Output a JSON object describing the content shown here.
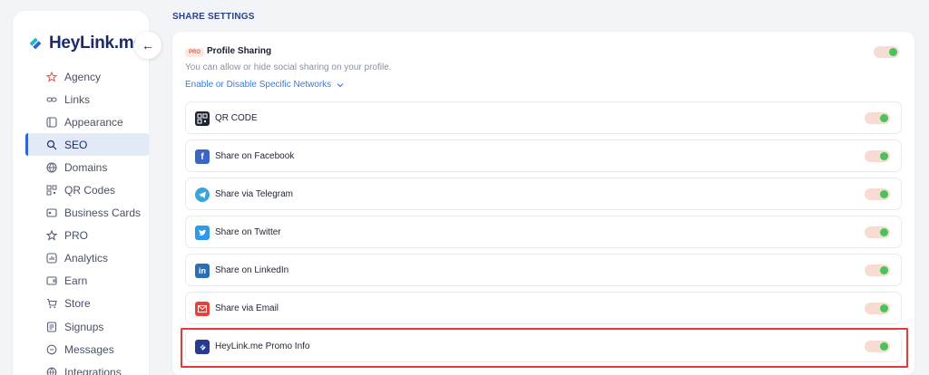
{
  "app": {
    "logo_text": "HeyLink.me",
    "collapse_icon": "arrow-left-icon"
  },
  "sidebar": {
    "items": [
      {
        "label": "Agency",
        "icon": "star-icon",
        "icon_color": "#e0644f"
      },
      {
        "label": "Links",
        "icon": "link-icon"
      },
      {
        "label": "Appearance",
        "icon": "palette-icon"
      },
      {
        "label": "SEO",
        "icon": "seo-icon",
        "active": true
      },
      {
        "label": "Domains",
        "icon": "globe-icon"
      },
      {
        "label": "QR Codes",
        "icon": "qr-icon"
      },
      {
        "label": "Business Cards",
        "icon": "id-card-icon"
      },
      {
        "label": "PRO",
        "icon": "crown-icon"
      },
      {
        "label": "Analytics",
        "icon": "chart-icon"
      },
      {
        "label": "Earn",
        "icon": "wallet-icon"
      },
      {
        "label": "Store",
        "icon": "cart-icon"
      },
      {
        "label": "Signups",
        "icon": "form-icon"
      },
      {
        "label": "Messages",
        "icon": "message-icon"
      },
      {
        "label": "Integrations",
        "icon": "plug-icon"
      }
    ]
  },
  "main": {
    "section_title": "SHARE SETTINGS",
    "profile_sharing": {
      "badge": "PRO",
      "title": "Profile Sharing",
      "description": "You can allow or hide social sharing on your profile.",
      "link": "Enable or Disable Specific Networks",
      "enabled": true
    },
    "networks": [
      {
        "label": "QR CODE",
        "icon": "qr-code-icon",
        "icon_color": "#1f2433",
        "enabled": true
      },
      {
        "label": "Share on Facebook",
        "icon": "facebook-icon",
        "icon_color": "#3b66c4",
        "enabled": true
      },
      {
        "label": "Share via Telegram",
        "icon": "telegram-icon",
        "icon_color": "#3aa3dd",
        "enabled": true
      },
      {
        "label": "Share on Twitter",
        "icon": "twitter-icon",
        "icon_color": "#2f9ae6",
        "enabled": true
      },
      {
        "label": "Share on LinkedIn",
        "icon": "linkedin-icon",
        "icon_color": "#2c6db4",
        "enabled": true
      },
      {
        "label": "Share via Email",
        "icon": "email-icon",
        "icon_color": "#e5433a",
        "enabled": true
      },
      {
        "label": "HeyLink.me Promo Info",
        "icon": "heylink-icon",
        "icon_color": "#2a3a8c",
        "enabled": true,
        "highlighted": true
      }
    ]
  },
  "colors": {
    "accent": "#2e66d6",
    "toggle_on": "#48c25b",
    "highlight": "#e23b3b"
  }
}
